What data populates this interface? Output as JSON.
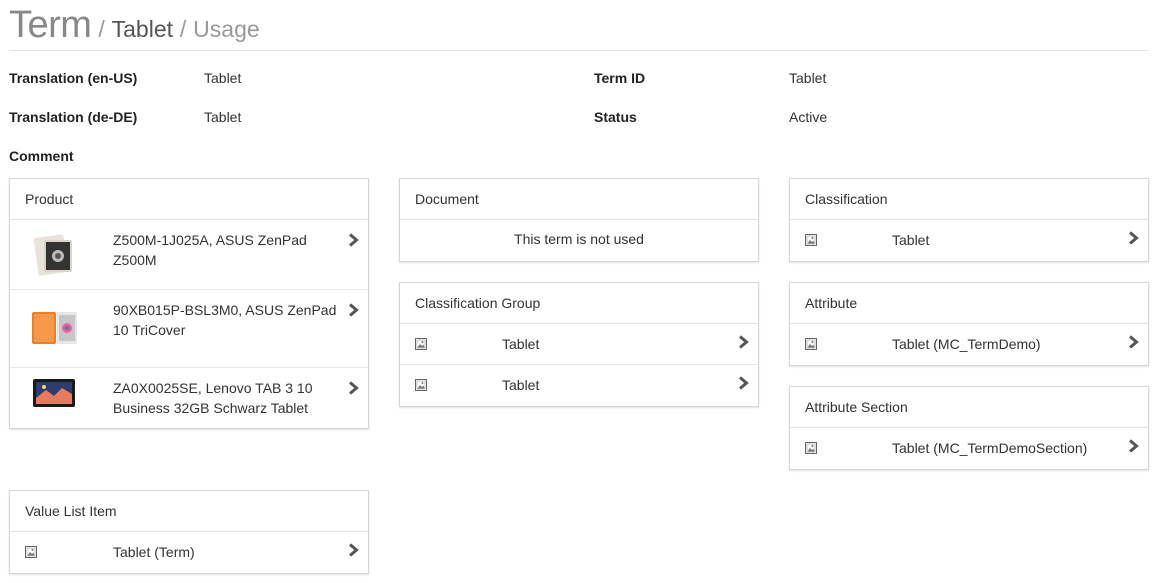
{
  "breadcrumb": {
    "term": "Term",
    "sep1": "/",
    "tablet": "Tablet",
    "sep2": "/",
    "usage": "Usage"
  },
  "properties": {
    "translation_en_label": "Translation (en-US)",
    "translation_en_value": "Tablet",
    "translation_de_label": "Translation (de-DE)",
    "translation_de_value": "Tablet",
    "term_id_label": "Term ID",
    "term_id_value": "Tablet",
    "status_label": "Status",
    "status_value": "Active",
    "comment_label": "Comment"
  },
  "panels": {
    "product": {
      "title": "Product",
      "items": [
        {
          "line1": "Z500M-1J025A, ASUS ZenPad",
          "line2": "Z500M"
        },
        {
          "line1": "90XB015P-BSL3M0, ASUS ZenPad",
          "line2": "10 TriCover"
        },
        {
          "line1": "ZA0X0025SE, Lenovo TAB 3 10",
          "line2": "Business 32GB Schwarz Tablet"
        }
      ]
    },
    "document": {
      "title": "Document",
      "empty": "This term is not used"
    },
    "classification_group": {
      "title": "Classification Group",
      "items": [
        "Tablet",
        "Tablet"
      ]
    },
    "classification": {
      "title": "Classification",
      "items": [
        "Tablet"
      ]
    },
    "attribute": {
      "title": "Attribute",
      "items": [
        "Tablet (MC_TermDemo)"
      ]
    },
    "attribute_section": {
      "title": "Attribute Section",
      "items": [
        "Tablet (MC_TermDemoSection)"
      ]
    },
    "value_list_item": {
      "title": "Value List Item",
      "items": [
        "Tablet (Term)"
      ]
    }
  },
  "colors": {
    "border": "#d6d6d6",
    "chevron": "#555555",
    "label": "#222222"
  }
}
